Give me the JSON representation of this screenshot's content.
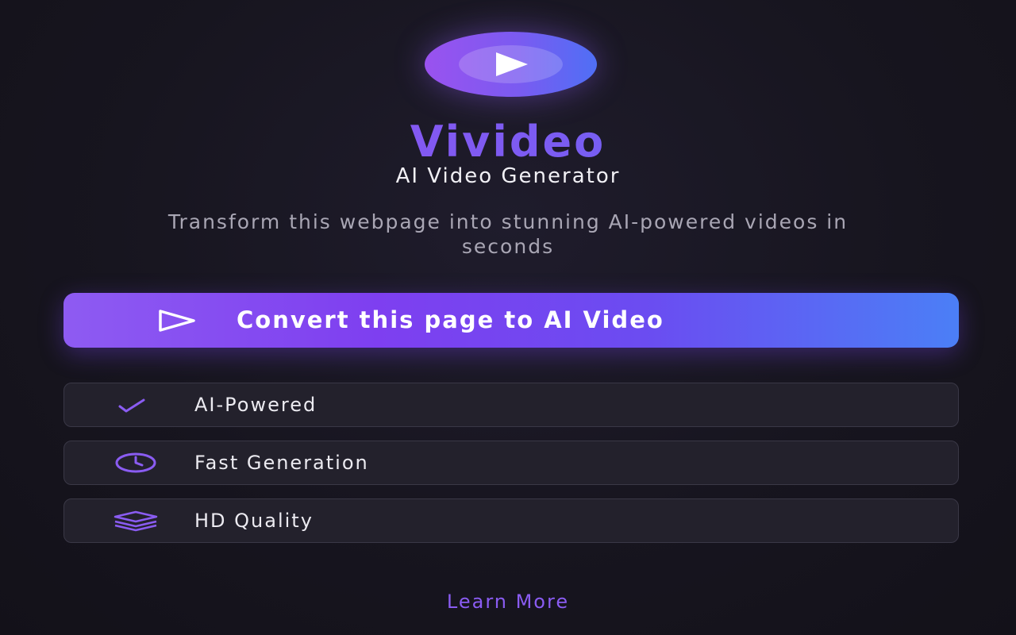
{
  "brand": {
    "name": "Vivideo",
    "tagline": "AI Video Generator"
  },
  "description": "Transform this webpage into stunning AI-powered videos in seconds",
  "convert_button": {
    "label": "Convert this page to AI Video",
    "icon": "play-outline-icon"
  },
  "features": [
    {
      "label": "AI-Powered",
      "icon": "check-icon"
    },
    {
      "label": "Fast Generation",
      "icon": "clock-icon"
    },
    {
      "label": "HD Quality",
      "icon": "layers-icon"
    }
  ],
  "learn_more": "Learn More",
  "colors": {
    "background": "#17151f",
    "accent_purple": "#8a55f0",
    "accent_blue": "#4f78f6",
    "card": "#23212c"
  }
}
